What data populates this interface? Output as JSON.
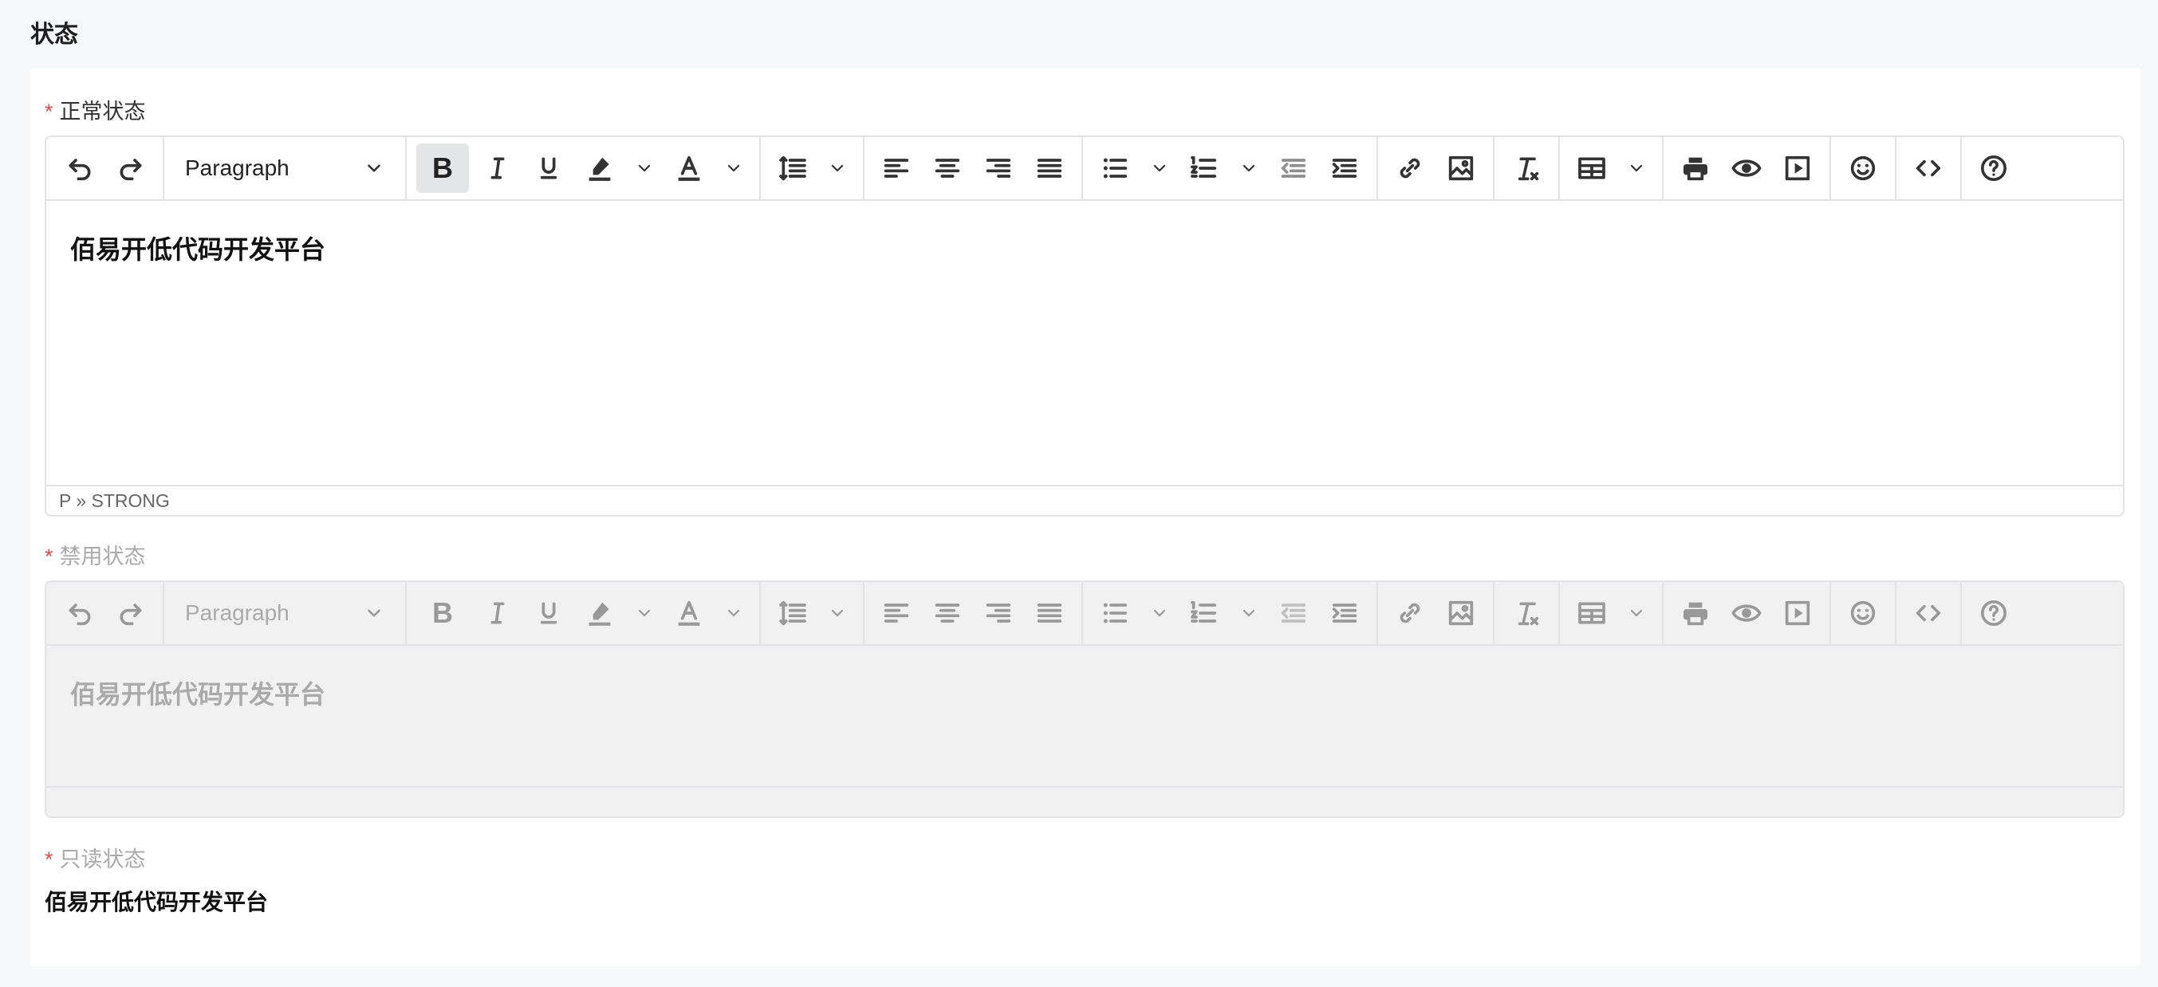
{
  "section_title": "状态",
  "required_mark": "*",
  "normal": {
    "label": "正常状态",
    "block_format": "Paragraph",
    "bold_glyph": "B",
    "content": "佰易开低代码开发平台",
    "status_path": "P » STRONG"
  },
  "disabled": {
    "label": "禁用状态",
    "block_format": "Paragraph",
    "bold_glyph": "B",
    "content": "佰易开低代码开发平台"
  },
  "readonly": {
    "label": "只读状态",
    "content": "佰易开低代码开发平台"
  },
  "colors": {
    "required": "#e24b4b",
    "border": "#e1e3e6",
    "disabled_bg": "#f1f1f1",
    "page_bg": "#f7f8fa"
  },
  "toolbar_icons": [
    "undo-icon",
    "redo-icon",
    "block-format-dropdown",
    "bold-icon",
    "italic-icon",
    "underline-icon",
    "highlight-color-icon",
    "text-color-icon",
    "line-height-icon",
    "align-left-icon",
    "align-center-icon",
    "align-right-icon",
    "align-justify-icon",
    "bullet-list-icon",
    "numbered-list-icon",
    "outdent-icon",
    "indent-icon",
    "link-icon",
    "image-icon",
    "clear-format-icon",
    "table-icon",
    "print-icon",
    "preview-icon",
    "media-icon",
    "emoji-icon",
    "code-icon",
    "help-icon"
  ]
}
